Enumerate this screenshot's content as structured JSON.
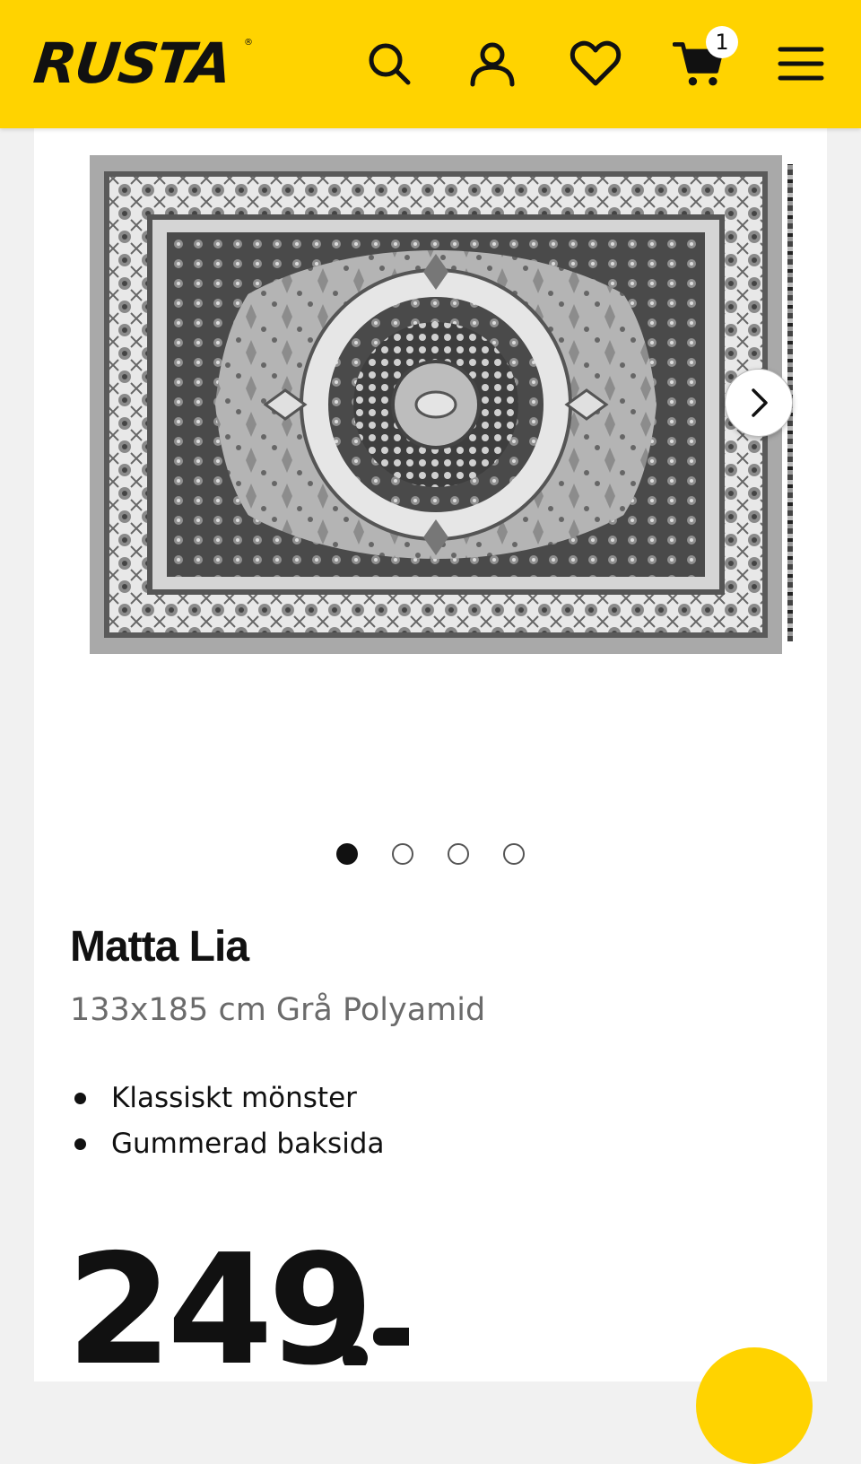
{
  "header": {
    "logo": "RUSTA",
    "logo_mark": "®",
    "icons": [
      "search-icon",
      "account-icon",
      "heart-icon",
      "cart-icon",
      "menu-icon"
    ],
    "cart_count": "1",
    "background": "#ffd300"
  },
  "gallery": {
    "image_alt": "rug-image",
    "dots": [
      true,
      false,
      false,
      false
    ]
  },
  "product": {
    "name": "Matta Lia",
    "details": "133x185 cm Grå Polyamid",
    "features": [
      "Klassiskt mönster",
      "Gummerad baksida"
    ],
    "price": "249",
    "price_suffix": ":-"
  }
}
